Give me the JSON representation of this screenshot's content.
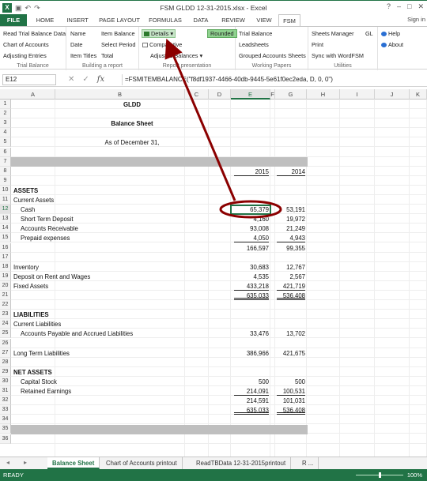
{
  "window": {
    "title": "FSM GLDD 12-31-2015.xlsx - Excel",
    "controls": [
      "?",
      "–",
      "□",
      "✕"
    ]
  },
  "ribbon_tabs": [
    "FILE",
    "HOME",
    "INSERT",
    "PAGE LAYOUT",
    "FORMULAS",
    "DATA",
    "REVIEW",
    "VIEW",
    "FSM"
  ],
  "sign_in": "Sign in",
  "ribbon": {
    "trial_balance": {
      "items": [
        "Read Trial Balance Data",
        "Chart of Accounts",
        "Adjusting Entries"
      ],
      "label": "Trial Balance"
    },
    "building_report": {
      "items": [
        "Name",
        "Item Balance",
        "Date",
        "Select Period",
        "Item Titles",
        "Total"
      ],
      "label": "Building a report"
    },
    "report_presentation": {
      "details": "Details",
      "comparative": "Comparative",
      "adjusted_balances": "Adjusted Balances",
      "rounded": "Rounded",
      "label": "Report presentation"
    },
    "working_papers": {
      "items": [
        "Trial Balance",
        "Leadsheets",
        "Grouped Accounts Sheets"
      ],
      "label": "Working Papers"
    },
    "utilities": {
      "items": [
        "Sheets Manager",
        "GL",
        "Print",
        "Sync with WordFSM"
      ],
      "label": "Utilities"
    },
    "help": {
      "items": [
        "Help",
        "About"
      ]
    }
  },
  "formula_bar": {
    "name_box": "E12",
    "formula": "=FSMITEMBALANCE(\"f8df1937-4466-40db-9445-5e61f0ec2eda, D, 0, 0\")"
  },
  "columns": [
    "A",
    "B",
    "C",
    "D",
    "E",
    "F",
    "G",
    "H",
    "I",
    "J",
    "K"
  ],
  "rows": [
    {
      "n": "1",
      "a": "",
      "b": "GLDD",
      "e": "",
      "g": ""
    },
    {
      "n": "2",
      "a": "",
      "b": "",
      "e": "",
      "g": ""
    },
    {
      "n": "3",
      "a": "",
      "b": "Balance Sheet",
      "e": "",
      "g": ""
    },
    {
      "n": "4",
      "a": "",
      "b": "",
      "e": "",
      "g": ""
    },
    {
      "n": "5",
      "a": "",
      "b": "As of December 31,",
      "e": "",
      "g": ""
    },
    {
      "n": "6",
      "a": "",
      "b": "",
      "e": "",
      "g": ""
    },
    {
      "n": "7",
      "a": "",
      "b": "",
      "e": "",
      "g": ""
    },
    {
      "n": "8",
      "a": "",
      "b": "",
      "e": "2015",
      "g": "2014"
    },
    {
      "n": "9",
      "a": "",
      "b": "",
      "e": "",
      "g": ""
    },
    {
      "n": "10",
      "a": "ASSETS",
      "b": "",
      "e": "",
      "g": ""
    },
    {
      "n": "11",
      "a": "Current Assets",
      "b": "",
      "e": "",
      "g": ""
    },
    {
      "n": "12",
      "a": "Cash",
      "b": "",
      "e": "65,379",
      "g": "53,191"
    },
    {
      "n": "13",
      "a": "Short Term Deposit",
      "b": "",
      "e": "4,160",
      "g": "19,972"
    },
    {
      "n": "14",
      "a": "Accounts Receivable",
      "b": "",
      "e": "93,008",
      "g": "21,249"
    },
    {
      "n": "15",
      "a": "Prepaid expenses",
      "b": "",
      "e": "4,050",
      "g": "4,943"
    },
    {
      "n": "16",
      "a": "",
      "b": "",
      "e": "166,597",
      "g": "99,355"
    },
    {
      "n": "17",
      "a": "",
      "b": "",
      "e": "",
      "g": ""
    },
    {
      "n": "18",
      "a": "Inventory",
      "b": "",
      "e": "30,683",
      "g": "12,767"
    },
    {
      "n": "19",
      "a": "Deposit on Rent and Wages",
      "b": "",
      "e": "4,535",
      "g": "2,567"
    },
    {
      "n": "20",
      "a": "Fixed Assets",
      "b": "",
      "e": "433,218",
      "g": "421,719"
    },
    {
      "n": "21",
      "a": "",
      "b": "",
      "e": "635,033",
      "g": "536,408"
    },
    {
      "n": "22",
      "a": "",
      "b": "",
      "e": "",
      "g": ""
    },
    {
      "n": "23",
      "a": "LIABILITIES",
      "b": "",
      "e": "",
      "g": ""
    },
    {
      "n": "24",
      "a": "Current Liabilities",
      "b": "",
      "e": "",
      "g": ""
    },
    {
      "n": "25",
      "a": "Accounts Payable and Accrued Liabilities",
      "b": "",
      "e": "33,476",
      "g": "13,702"
    },
    {
      "n": "26",
      "a": "",
      "b": "",
      "e": "",
      "g": ""
    },
    {
      "n": "27",
      "a": "Long Term Liabilities",
      "b": "",
      "e": "386,966",
      "g": "421,675"
    },
    {
      "n": "28",
      "a": "",
      "b": "",
      "e": "",
      "g": ""
    },
    {
      "n": "29",
      "a": "NET ASSETS",
      "b": "",
      "e": "",
      "g": ""
    },
    {
      "n": "30",
      "a": "Capital Stock",
      "b": "",
      "e": "500",
      "g": "500"
    },
    {
      "n": "31",
      "a": "Retained Earnings",
      "b": "",
      "e": "214,091",
      "g": "100,531"
    },
    {
      "n": "32",
      "a": "",
      "b": "",
      "e": "214,591",
      "g": "101,031"
    },
    {
      "n": "33",
      "a": "",
      "b": "",
      "e": "635,033",
      "g": "536,408"
    },
    {
      "n": "34",
      "a": "",
      "b": "",
      "e": "",
      "g": ""
    },
    {
      "n": "35",
      "a": "",
      "b": "",
      "e": "",
      "g": ""
    },
    {
      "n": "36",
      "a": "",
      "b": "",
      "e": "",
      "g": ""
    }
  ],
  "sheet_tabs": [
    "Balance Sheet",
    "Chart of Accounts printout",
    "ReadTBData 12-31-2015printout",
    "R ..."
  ],
  "status": {
    "ready": "READY",
    "zoom": "100%"
  },
  "colors": {
    "excel_green": "#217346",
    "annotation": "#8b0000"
  }
}
